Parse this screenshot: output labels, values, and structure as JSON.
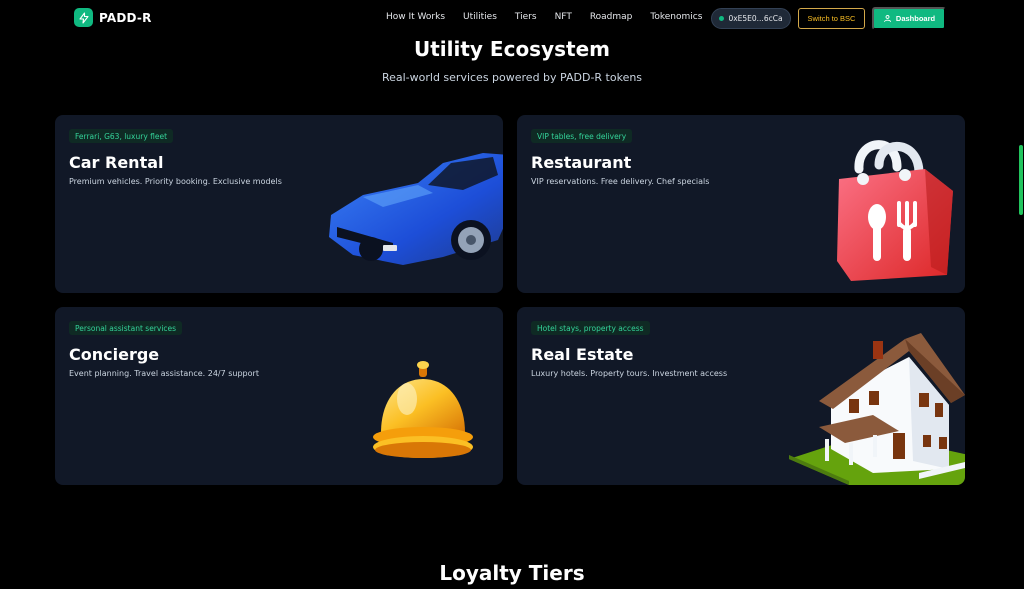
{
  "brand": {
    "name": "PADD-R"
  },
  "nav": {
    "links": [
      "How It Works",
      "Utilities",
      "Tiers",
      "NFT",
      "Roadmap",
      "Tokenomics"
    ],
    "wallet": "0xE5E0...6cCa",
    "switch_label": "Switch to BSC",
    "dashboard_label": "Dashboard"
  },
  "section": {
    "title": "Utility Ecosystem",
    "subtitle": "Real-world services powered by PADD-R tokens"
  },
  "cards": [
    {
      "badge": "Ferrari, G63, luxury fleet",
      "title": "Car Rental",
      "desc": "Premium vehicles. Priority booking. Exclusive models"
    },
    {
      "badge": "VIP tables, free delivery",
      "title": "Restaurant",
      "desc": "VIP reservations. Free delivery. Chef specials"
    },
    {
      "badge": "Personal assistant services",
      "title": "Concierge",
      "desc": "Event planning. Travel assistance. 24/7 support"
    },
    {
      "badge": "Hotel stays, property access",
      "title": "Real Estate",
      "desc": "Luxury hotels. Property tours. Investment access"
    }
  ],
  "next_section": {
    "title": "Loyalty Tiers"
  },
  "colors": {
    "accent": "#10b981",
    "gold": "#fbbf24",
    "card_bg": "#111827"
  },
  "icons": {
    "brand": "lightning-icon",
    "wallet": "status-dot-icon",
    "dashboard": "user-icon"
  }
}
